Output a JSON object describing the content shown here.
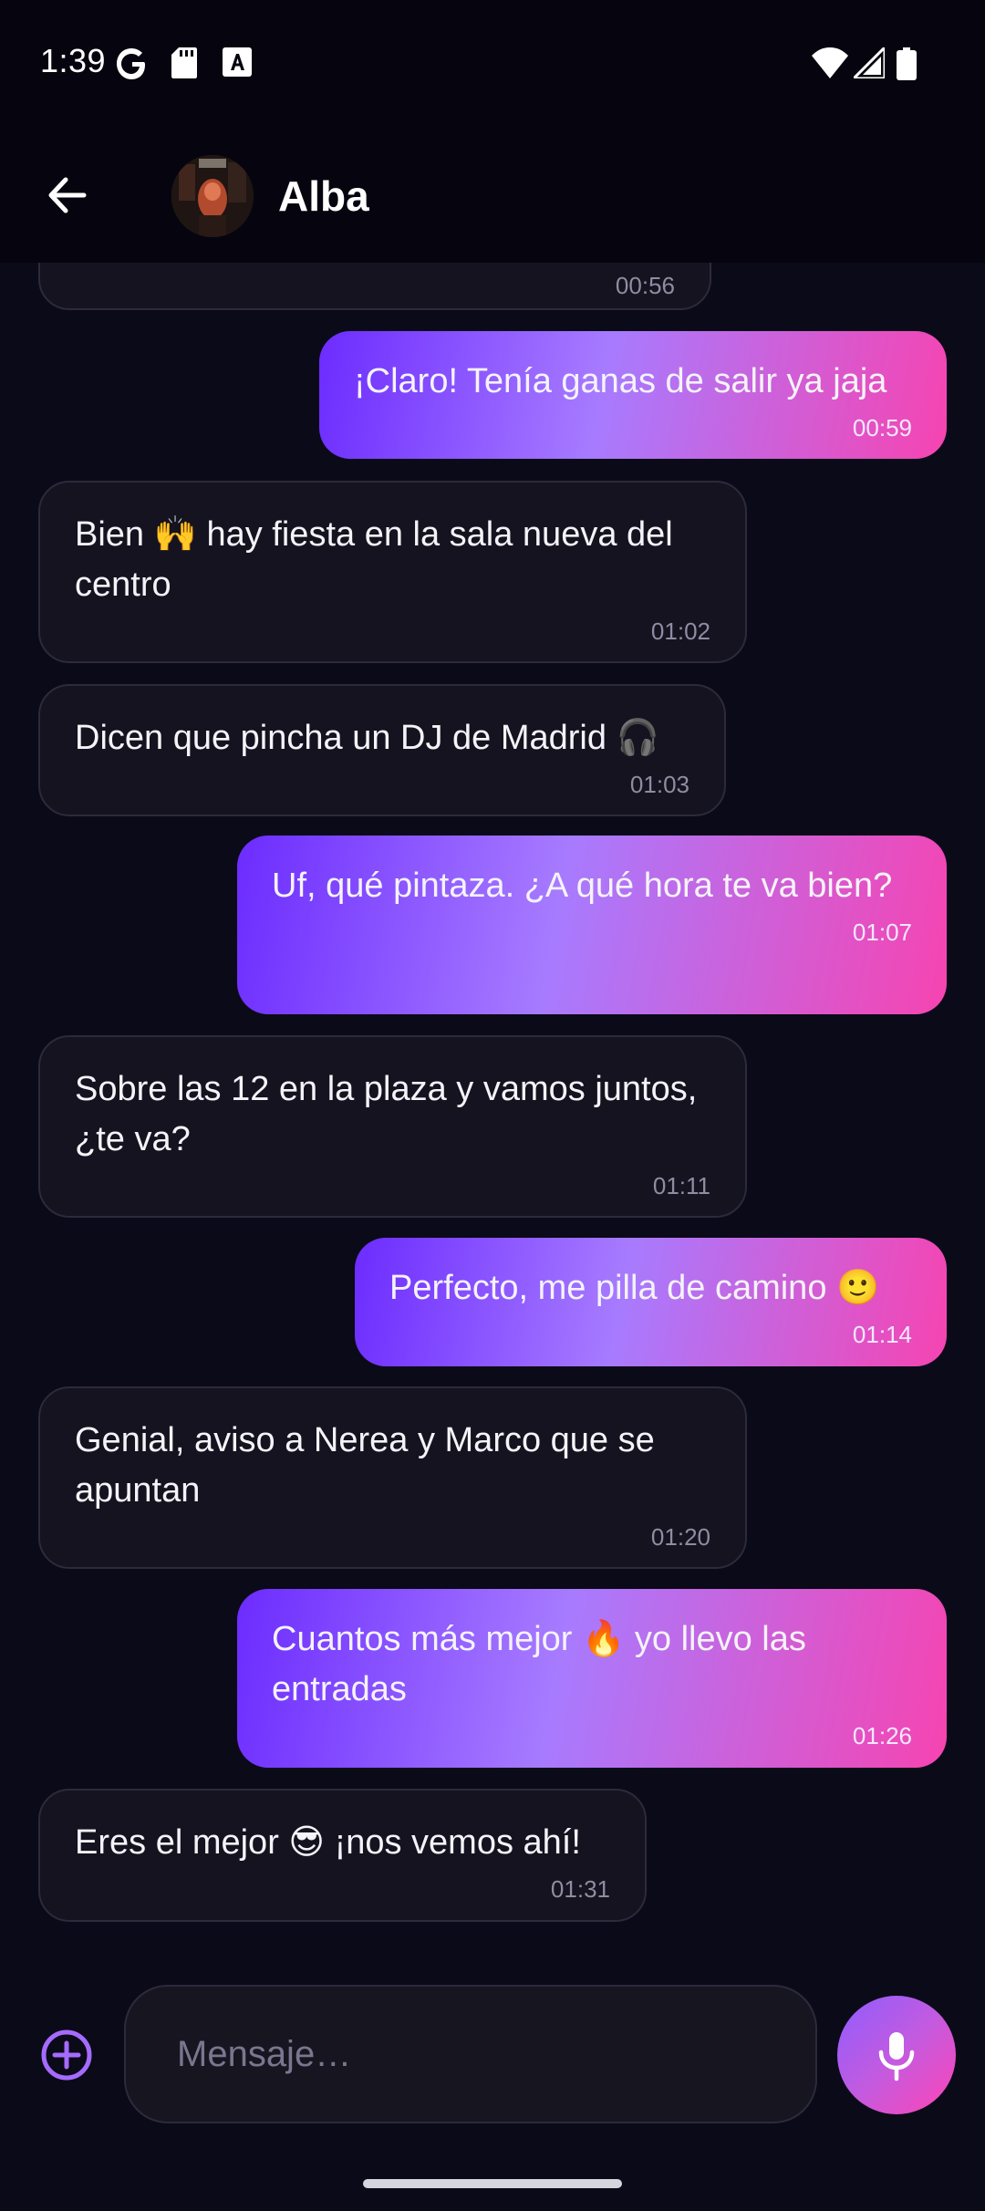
{
  "status_bar": {
    "time": "1:39",
    "left_icons": [
      "google-icon",
      "sd-card-icon",
      "font-a-icon"
    ],
    "right_icons": [
      "wifi-icon",
      "signal-icon",
      "battery-icon"
    ]
  },
  "header": {
    "contact_name": "Alba",
    "avatar": "contact-avatar"
  },
  "messages": [
    {
      "direction": "in",
      "text": "",
      "time": "00:56"
    },
    {
      "direction": "out",
      "text": "¡Claro! Tenía ganas de salir ya jaja",
      "time": "00:59"
    },
    {
      "direction": "in",
      "text": "Bien 🙌 hay fiesta en la sala nueva del centro",
      "time": "01:02"
    },
    {
      "direction": "in",
      "text": "Dicen que pincha un DJ de Madrid 🎧",
      "time": "01:03"
    },
    {
      "direction": "out",
      "text": "Uf, qué pintaza. ¿A qué hora te va bien?",
      "time": "01:07"
    },
    {
      "direction": "in",
      "text": "Sobre las 12 en la plaza y vamos juntos, ¿te va?",
      "time": "01:11"
    },
    {
      "direction": "out",
      "text": "Perfecto, me pilla de camino 🙂",
      "time": "01:14"
    },
    {
      "direction": "in",
      "text": "Genial, aviso a Nerea y Marco que se apuntan",
      "time": "01:20"
    },
    {
      "direction": "out",
      "text": "Cuantos más mejor 🔥 yo llevo las entradas",
      "time": "01:26"
    },
    {
      "direction": "in",
      "text": "Eres el mejor 😎 ¡nos vemos ahí!",
      "time": "01:31"
    }
  ],
  "composer": {
    "placeholder": "Mensaje…",
    "value": ""
  },
  "colors": {
    "background": "#0b0a18",
    "incoming_bubble": "#15131f",
    "outgoing_gradient_start": "#6c2cff",
    "outgoing_gradient_mid": "#a77bff",
    "outgoing_gradient_end": "#f644b1",
    "accent": "#a56bff"
  }
}
